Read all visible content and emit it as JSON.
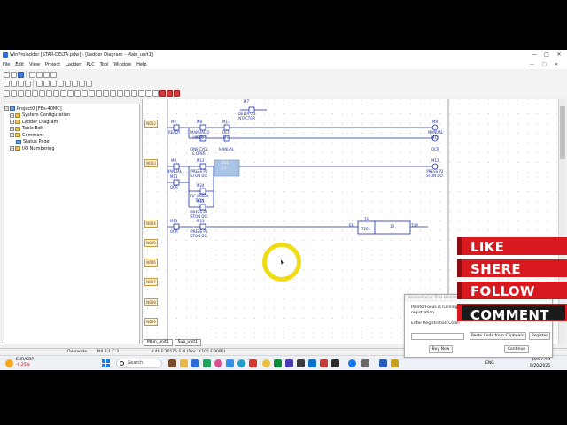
{
  "window": {
    "title": "WinProladder [STAR-DELTA.pdw] - [Ladder Diagram - Main_unit1]",
    "controls": [
      "—",
      "□",
      "✕"
    ],
    "mdi_controls": [
      "—",
      "□",
      "✕"
    ]
  },
  "menu": [
    "File",
    "Edit",
    "View",
    "Project",
    "Ladder",
    "PLC",
    "Tool",
    "Window",
    "Help"
  ],
  "tree": {
    "root": "Project0 [FBs-40MC]",
    "items": [
      "System Configuration",
      "Ladder Diagram",
      "Table Edit",
      "Comment",
      "Status Page",
      "I/O Numbering"
    ]
  },
  "rungs": [
    "N002",
    "N003",
    "N004",
    "N005",
    "N006",
    "N007",
    "N008",
    "N009"
  ],
  "ladder": {
    "top_coil": {
      "addr": "M7",
      "label": "DELTA CO\nNTACTOR"
    },
    "r2_c1": {
      "addr": "M2",
      "label": "READY"
    },
    "r2_c2": {
      "addr": "M8",
      "label": "MANUAL O\nperation"
    },
    "r2_c3": {
      "addr": "M11",
      "label": "OCR"
    },
    "r2_coil": {
      "addr": "M9",
      "label": "MANUAL"
    },
    "r2b_c1": {
      "addr": "M10",
      "label": "ONE CYCL\nE OPER."
    },
    "r2b_c2": {
      "addr": "M9",
      "label": "MANUAL"
    },
    "r2b_coil": {
      "addr": "M11",
      "label": "OCR"
    },
    "r3_c1": {
      "addr": "M9",
      "label": "MANUAL"
    },
    "r3_c2": {
      "addr": "M12",
      "label": "PRESS P2\nSTON DO."
    },
    "r3_sel": {
      "addr": "101",
      "label": "(-)"
    },
    "r3_coil": {
      "addr": "M12",
      "label": "PRESS P2\nSTON DO."
    },
    "r3b_c1": {
      "addr": "M11",
      "label": "OCR"
    },
    "r3b_c2": {
      "addr": "M24",
      "label": "DC OPERA\nTION"
    },
    "r3c_c2": {
      "addr": "M13",
      "label": "PRESS P2\nSTON DO."
    },
    "r4_c1": {
      "addr": "M11",
      "label": "OCR"
    },
    "r4_c2": {
      "addr": "M13",
      "label": "PRESS P1\nSTON DO."
    },
    "r4_en": "EN",
    "r4_timer": {
      "addr": "1S",
      "name": "T201",
      "value": "10"
    },
    "r4_tup": "TUP"
  },
  "tabs": [
    "Main_unit1",
    "Sub_unit1"
  ],
  "status": {
    "mode": "Overwrite",
    "node": "N8 R:1 C:3",
    "info": "U:48 F:20175 S:N (Doc U:105 F:8086)"
  },
  "taskbar": {
    "weather_ticker": "EUR/GBP",
    "weather_value": "-0.25%",
    "search": "Search",
    "lang": "ENG",
    "time": "10:07 AM",
    "date": "9/20/2025"
  },
  "popup": {
    "title": "PointerFocus Trial Version",
    "line1": "PointerFocus is running in trial mode. Please register.",
    "line2": "registration.",
    "label": "Enter Registration Code:",
    "paste_button": "Paste Code from Clipboard",
    "register_button": "Register",
    "buy_button": "Buy Now",
    "continue_button": "Continue"
  },
  "overlay": [
    "LIKE",
    "SHERE",
    "FOLLOW",
    "COMMENT"
  ],
  "colors": {
    "banner_red": "#d8191f",
    "banner_dark": "#1a1a1a",
    "pointer_yellow": "#f0dc16",
    "ladder_blue": "#1b2fa8"
  }
}
